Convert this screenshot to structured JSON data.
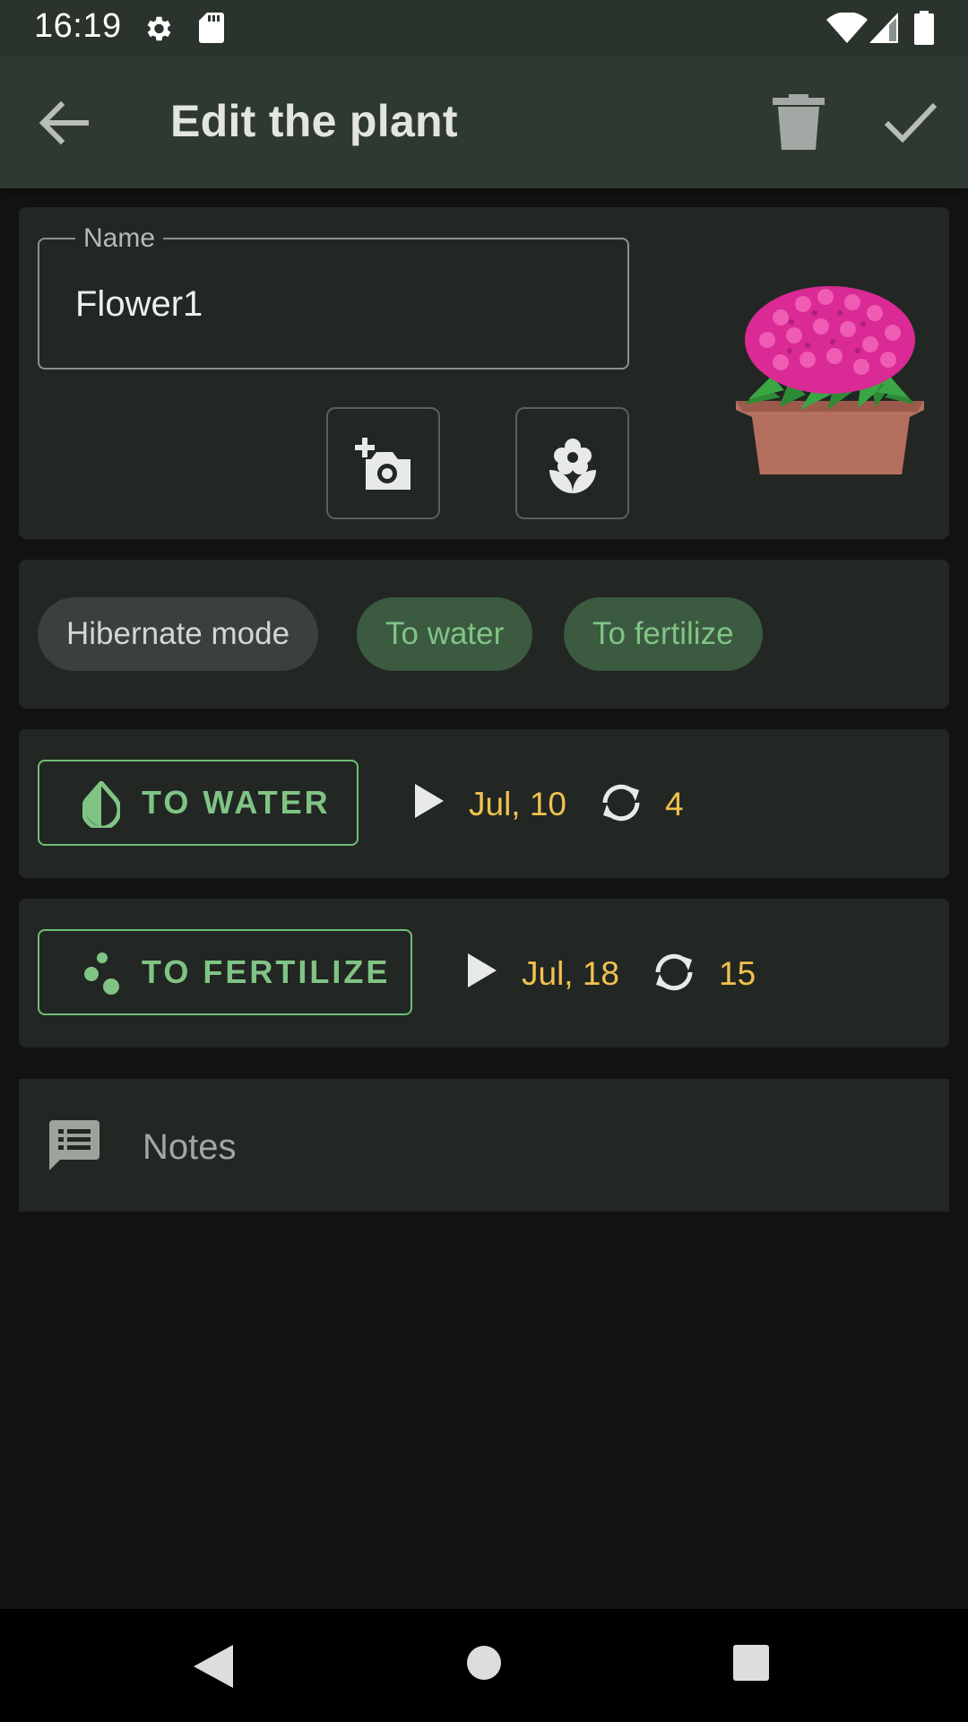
{
  "status_bar": {
    "time": "16:19",
    "icons": [
      "settings-icon",
      "sd-card-icon",
      "wifi-icon",
      "cell-signal-icon",
      "battery-icon"
    ]
  },
  "app_bar": {
    "title": "Edit the plant",
    "actions": [
      "back-arrow-icon",
      "trash-icon",
      "check-icon"
    ]
  },
  "plant": {
    "name_label": "Name",
    "name_value": "Flower1",
    "image_buttons": [
      "add-photo-icon",
      "flower-icon"
    ]
  },
  "chips": [
    {
      "label": "Hibernate mode",
      "selected": false
    },
    {
      "label": "To water",
      "selected": true
    },
    {
      "label": "To fertilize",
      "selected": true
    }
  ],
  "tasks": {
    "water": {
      "button_label": "TO WATER",
      "icon": "water-drop-icon",
      "next_date": "Jul, 10",
      "interval": "4"
    },
    "fertilize": {
      "button_label": "TO FERTILIZE",
      "icon": "fertilizer-icon",
      "next_date": "Jul, 18",
      "interval": "15"
    }
  },
  "notes": {
    "label": "Notes",
    "icon": "notes-icon"
  },
  "colors": {
    "accent_green": "#80c485",
    "date_yellow": "#f2c24f",
    "appbar": "#2e3a31",
    "card": "#222723",
    "background": "#121212"
  },
  "nav_bar": [
    "nav-back-icon",
    "nav-home-icon",
    "nav-recents-icon"
  ]
}
